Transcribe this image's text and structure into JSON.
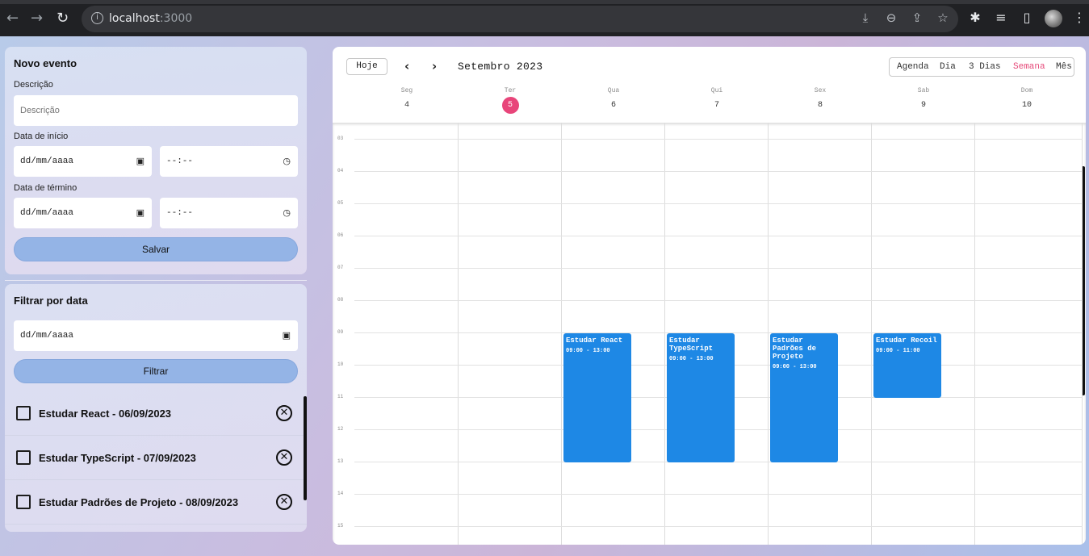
{
  "browser": {
    "url_host": "localhost",
    "url_port": ":3000",
    "icons": [
      "back-icon",
      "forward-icon",
      "reload-icon",
      "info-icon",
      "install-icon",
      "zoom-icon",
      "share-icon",
      "star-icon",
      "extensions-icon",
      "media-icon",
      "sidepanel-icon",
      "profile-avatar",
      "menu-icon"
    ]
  },
  "new_event": {
    "title": "Novo evento",
    "description_label": "Descrição",
    "description_placeholder": "Descrição",
    "start_label": "Data de início",
    "end_label": "Data de término",
    "date_placeholder": "dd/mm/aaaa",
    "time_placeholder": "--:--",
    "save_label": "Salvar"
  },
  "filter": {
    "title": "Filtrar por data",
    "date_placeholder": "dd/mm/aaaa",
    "filter_label": "Filtrar"
  },
  "events_list": [
    {
      "label": "Estudar React - 06/09/2023"
    },
    {
      "label": "Estudar TypeScript - 07/09/2023"
    },
    {
      "label": "Estudar Padrões de Projeto - 08/09/2023"
    }
  ],
  "calendar": {
    "today_label": "Hoje",
    "prev_icon": "‹",
    "next_icon": "›",
    "month_label": "Setembro 2023",
    "views": [
      "Agenda",
      "Dia",
      "3 Dias",
      "Semana",
      "Mês"
    ],
    "active_view": "Semana",
    "days": [
      {
        "name": "Seg",
        "date": "4"
      },
      {
        "name": "Ter",
        "date": "5",
        "today": true
      },
      {
        "name": "Qua",
        "date": "6"
      },
      {
        "name": "Qui",
        "date": "7"
      },
      {
        "name": "Sex",
        "date": "8"
      },
      {
        "name": "Sab",
        "date": "9"
      },
      {
        "name": "Dom",
        "date": "10"
      }
    ],
    "hours": [
      "03",
      "04",
      "05",
      "06",
      "07",
      "08",
      "09",
      "10",
      "11",
      "12",
      "13",
      "14",
      "15"
    ],
    "events": [
      {
        "title": "Estudar React",
        "time": "09:00 - 13:00",
        "day": "Qua"
      },
      {
        "title": "Estudar TypeScript",
        "time": "09:00 - 13:00",
        "day": "Qui"
      },
      {
        "title": "Estudar Padrões de Projeto",
        "time": "09:00 - 13:00",
        "day": "Sex"
      },
      {
        "title": "Estudar Recoil",
        "time": "09:00 - 11:00",
        "day": "Sab"
      }
    ],
    "accent_color": "#e8457a",
    "event_color": "#1e88e5"
  }
}
